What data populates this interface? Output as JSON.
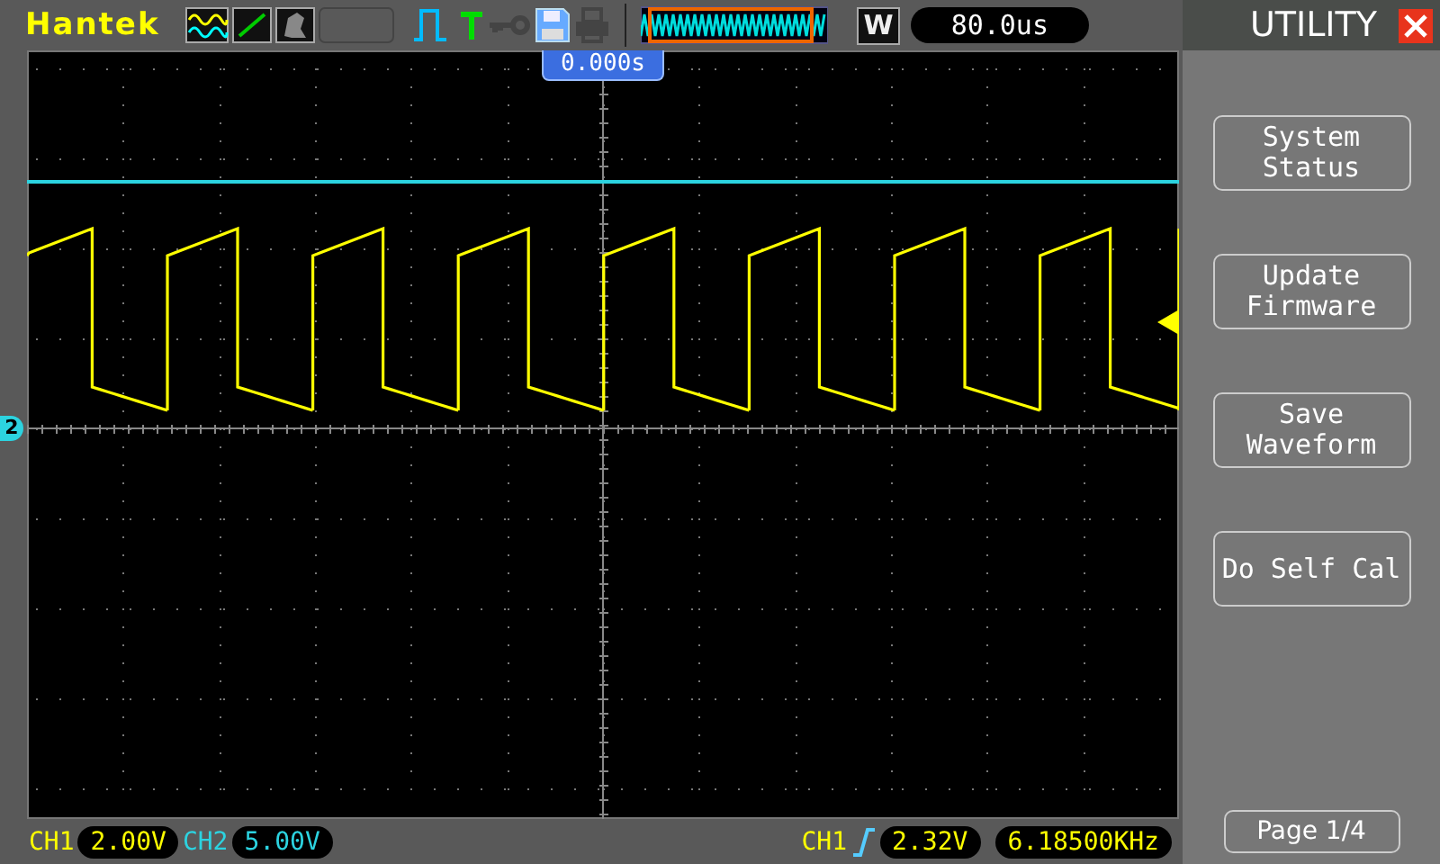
{
  "header": {
    "logo": "Hantek",
    "timebase_mode": "W",
    "timebase": "80.0us"
  },
  "screen": {
    "trigger_position": "0.000s",
    "channel_marker": "2"
  },
  "status_bar": {
    "ch1_label": "CH1",
    "ch1_scale": "2.00V",
    "ch2_label": "CH2",
    "ch2_scale": "5.00V",
    "trigger_source": "CH1",
    "trigger_level": "2.32V",
    "frequency": "6.18500KHz"
  },
  "menu": {
    "title": "UTILITY",
    "buttons": [
      {
        "label": "System\nStatus"
      },
      {
        "label": "Update\nFirmware"
      },
      {
        "label": "Save\nWaveform"
      },
      {
        "label": "Do Self Cal"
      }
    ],
    "page": "Page 1/4"
  }
}
